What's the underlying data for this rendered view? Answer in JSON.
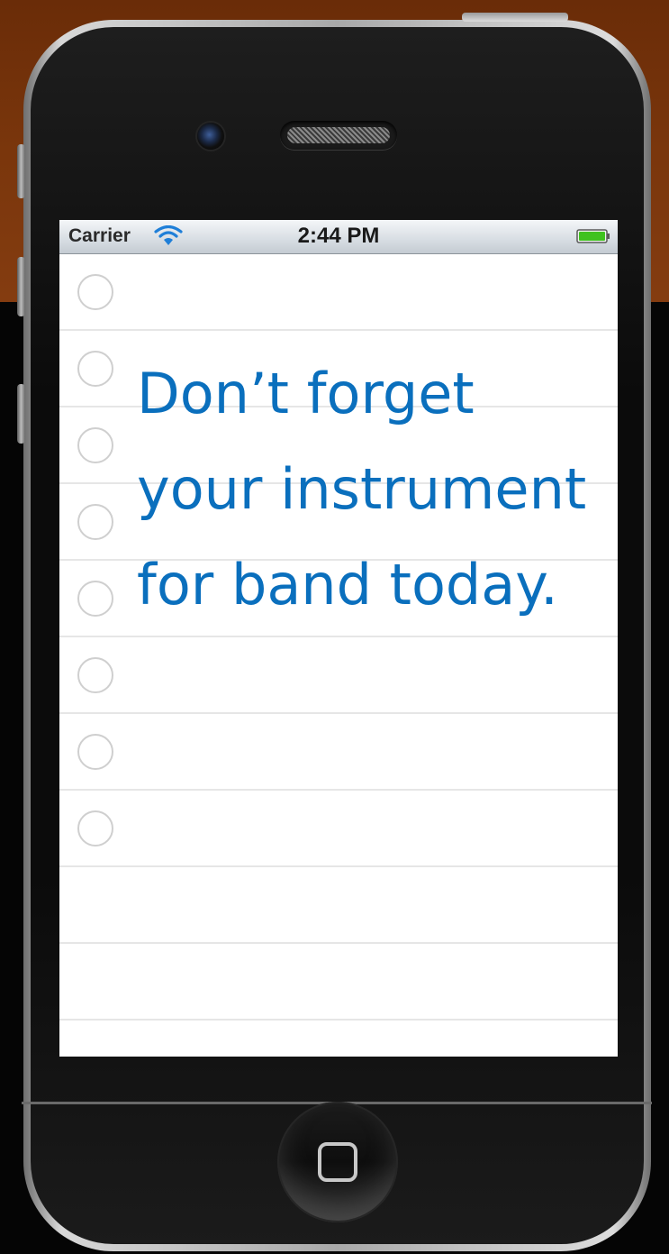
{
  "status_bar": {
    "carrier": "Carrier",
    "time": "2:44 PM",
    "wifi_icon": "wifi-icon",
    "battery_icon": "battery-icon",
    "battery_color": "#3fc21f"
  },
  "note": {
    "text": "Don’t forget your instrument for band today.",
    "text_color": "#0a6fbd"
  },
  "checklist": {
    "circle_count": 8
  },
  "colors": {
    "background_top": "#7a360c",
    "background_bottom": "#050505"
  }
}
